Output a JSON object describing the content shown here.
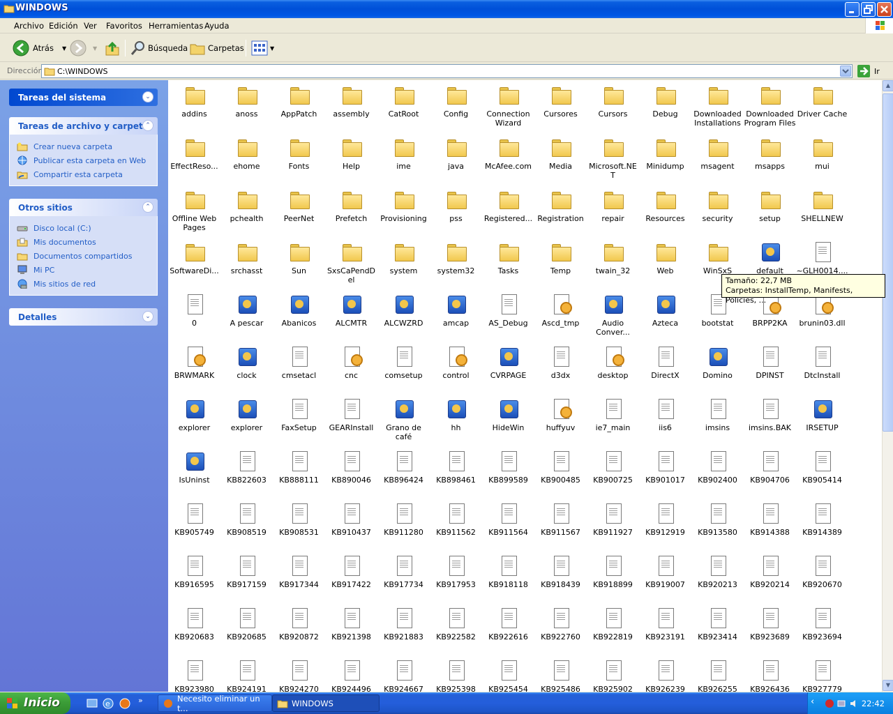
{
  "window": {
    "title": "WINDOWS"
  },
  "menu": [
    "Archivo",
    "Edición",
    "Ver",
    "Favoritos",
    "Herramientas",
    "Ayuda"
  ],
  "toolbar": {
    "back_label": "Atrás",
    "search_label": "Búsqueda",
    "folders_label": "Carpetas"
  },
  "address": {
    "label": "Dirección",
    "value": "C:\\WINDOWS",
    "go_label": "Ir"
  },
  "sidebar": {
    "system_tasks": {
      "title": "Tareas del sistema"
    },
    "file_tasks": {
      "title": "Tareas de archivo y carpeta",
      "items": [
        "Crear nueva carpeta",
        "Publicar esta carpeta en Web",
        "Compartir esta carpeta"
      ]
    },
    "other_places": {
      "title": "Otros sitios",
      "items": [
        "Disco local (C:)",
        "Mis documentos",
        "Documentos compartidos",
        "Mi PC",
        "Mis sitios de red"
      ]
    },
    "details": {
      "title": "Detalles"
    }
  },
  "files": [
    {
      "name": "addins",
      "type": "folder"
    },
    {
      "name": "anoss",
      "type": "folder"
    },
    {
      "name": "AppPatch",
      "type": "folder"
    },
    {
      "name": "assembly",
      "type": "folder"
    },
    {
      "name": "CatRoot",
      "type": "folder"
    },
    {
      "name": "Config",
      "type": "folder"
    },
    {
      "name": "Connection Wizard",
      "type": "folder"
    },
    {
      "name": "Cursores",
      "type": "folder"
    },
    {
      "name": "Cursors",
      "type": "folder"
    },
    {
      "name": "Debug",
      "type": "folder"
    },
    {
      "name": "Downloaded Installations",
      "type": "folder"
    },
    {
      "name": "Downloaded Program Files",
      "type": "folder"
    },
    {
      "name": "Driver Cache",
      "type": "folder"
    },
    {
      "name": "EffectReso...",
      "type": "folder"
    },
    {
      "name": "ehome",
      "type": "folder"
    },
    {
      "name": "Fonts",
      "type": "folder"
    },
    {
      "name": "Help",
      "type": "folder"
    },
    {
      "name": "ime",
      "type": "folder"
    },
    {
      "name": "java",
      "type": "folder"
    },
    {
      "name": "McAfee.com",
      "type": "folder"
    },
    {
      "name": "Media",
      "type": "folder"
    },
    {
      "name": "Microsoft.NET",
      "type": "folder"
    },
    {
      "name": "Minidump",
      "type": "folder"
    },
    {
      "name": "msagent",
      "type": "folder"
    },
    {
      "name": "msapps",
      "type": "folder"
    },
    {
      "name": "mui",
      "type": "folder"
    },
    {
      "name": "Offline Web Pages",
      "type": "folder"
    },
    {
      "name": "pchealth",
      "type": "folder"
    },
    {
      "name": "PeerNet",
      "type": "folder"
    },
    {
      "name": "Prefetch",
      "type": "folder"
    },
    {
      "name": "Provisioning",
      "type": "folder"
    },
    {
      "name": "pss",
      "type": "folder"
    },
    {
      "name": "Registered...",
      "type": "folder"
    },
    {
      "name": "Registration",
      "type": "folder"
    },
    {
      "name": "repair",
      "type": "folder"
    },
    {
      "name": "Resources",
      "type": "folder"
    },
    {
      "name": "security",
      "type": "folder"
    },
    {
      "name": "setup",
      "type": "folder"
    },
    {
      "name": "SHELLNEW",
      "type": "folder"
    },
    {
      "name": "SoftwareDi...",
      "type": "folder"
    },
    {
      "name": "srchasst",
      "type": "folder"
    },
    {
      "name": "Sun",
      "type": "folder"
    },
    {
      "name": "SxsCaPendDel",
      "type": "folder"
    },
    {
      "name": "system",
      "type": "folder"
    },
    {
      "name": "system32",
      "type": "folder"
    },
    {
      "name": "Tasks",
      "type": "folder"
    },
    {
      "name": "Temp",
      "type": "folder"
    },
    {
      "name": "twain_32",
      "type": "folder"
    },
    {
      "name": "Web",
      "type": "folder"
    },
    {
      "name": "WinSxS",
      "type": "folder"
    },
    {
      "name": "default",
      "type": "exe"
    },
    {
      "name": "~GLH0014....",
      "type": "doc"
    },
    {
      "name": "0",
      "type": "doc"
    },
    {
      "name": "A pescar",
      "type": "exe"
    },
    {
      "name": "Abanicos",
      "type": "exe"
    },
    {
      "name": "ALCMTR",
      "type": "exe"
    },
    {
      "name": "ALCWZRD",
      "type": "exe"
    },
    {
      "name": "amcap",
      "type": "exe"
    },
    {
      "name": "AS_Debug",
      "type": "doc"
    },
    {
      "name": "Ascd_tmp",
      "type": "cfg"
    },
    {
      "name": "Audio Conver...",
      "type": "exe"
    },
    {
      "name": "Azteca",
      "type": "exe"
    },
    {
      "name": "bootstat",
      "type": "doc"
    },
    {
      "name": "BRPP2KA",
      "type": "cfg"
    },
    {
      "name": "brunin03.dll",
      "type": "cfg"
    },
    {
      "name": "BRWMARK",
      "type": "cfg"
    },
    {
      "name": "clock",
      "type": "exe"
    },
    {
      "name": "cmsetacl",
      "type": "doc"
    },
    {
      "name": "cnc",
      "type": "cfg"
    },
    {
      "name": "comsetup",
      "type": "doc"
    },
    {
      "name": "control",
      "type": "cfg"
    },
    {
      "name": "CVRPAGE",
      "type": "exe"
    },
    {
      "name": "d3dx",
      "type": "doc"
    },
    {
      "name": "desktop",
      "type": "cfg"
    },
    {
      "name": "DirectX",
      "type": "doc"
    },
    {
      "name": "Domino",
      "type": "exe"
    },
    {
      "name": "DPINST",
      "type": "doc"
    },
    {
      "name": "DtcInstall",
      "type": "doc"
    },
    {
      "name": "explorer",
      "type": "exe"
    },
    {
      "name": "explorer",
      "type": "exe"
    },
    {
      "name": "FaxSetup",
      "type": "doc"
    },
    {
      "name": "GEARInstall",
      "type": "doc"
    },
    {
      "name": "Grano de café",
      "type": "exe"
    },
    {
      "name": "hh",
      "type": "exe"
    },
    {
      "name": "HideWin",
      "type": "exe"
    },
    {
      "name": "huffyuv",
      "type": "cfg"
    },
    {
      "name": "ie7_main",
      "type": "doc"
    },
    {
      "name": "iis6",
      "type": "doc"
    },
    {
      "name": "imsins",
      "type": "doc"
    },
    {
      "name": "imsins.BAK",
      "type": "doc"
    },
    {
      "name": "IRSETUP",
      "type": "exe"
    },
    {
      "name": "IsUninst",
      "type": "exe"
    },
    {
      "name": "KB822603",
      "type": "doc"
    },
    {
      "name": "KB888111",
      "type": "doc"
    },
    {
      "name": "KB890046",
      "type": "doc"
    },
    {
      "name": "KB896424",
      "type": "doc"
    },
    {
      "name": "KB898461",
      "type": "doc"
    },
    {
      "name": "KB899589",
      "type": "doc"
    },
    {
      "name": "KB900485",
      "type": "doc"
    },
    {
      "name": "KB900725",
      "type": "doc"
    },
    {
      "name": "KB901017",
      "type": "doc"
    },
    {
      "name": "KB902400",
      "type": "doc"
    },
    {
      "name": "KB904706",
      "type": "doc"
    },
    {
      "name": "KB905414",
      "type": "doc"
    },
    {
      "name": "KB905749",
      "type": "doc"
    },
    {
      "name": "KB908519",
      "type": "doc"
    },
    {
      "name": "KB908531",
      "type": "doc"
    },
    {
      "name": "KB910437",
      "type": "doc"
    },
    {
      "name": "KB911280",
      "type": "doc"
    },
    {
      "name": "KB911562",
      "type": "doc"
    },
    {
      "name": "KB911564",
      "type": "doc"
    },
    {
      "name": "KB911567",
      "type": "doc"
    },
    {
      "name": "KB911927",
      "type": "doc"
    },
    {
      "name": "KB912919",
      "type": "doc"
    },
    {
      "name": "KB913580",
      "type": "doc"
    },
    {
      "name": "KB914388",
      "type": "doc"
    },
    {
      "name": "KB914389",
      "type": "doc"
    },
    {
      "name": "KB916595",
      "type": "doc"
    },
    {
      "name": "KB917159",
      "type": "doc"
    },
    {
      "name": "KB917344",
      "type": "doc"
    },
    {
      "name": "KB917422",
      "type": "doc"
    },
    {
      "name": "KB917734",
      "type": "doc"
    },
    {
      "name": "KB917953",
      "type": "doc"
    },
    {
      "name": "KB918118",
      "type": "doc"
    },
    {
      "name": "KB918439",
      "type": "doc"
    },
    {
      "name": "KB918899",
      "type": "doc"
    },
    {
      "name": "KB919007",
      "type": "doc"
    },
    {
      "name": "KB920213",
      "type": "doc"
    },
    {
      "name": "KB920214",
      "type": "doc"
    },
    {
      "name": "KB920670",
      "type": "doc"
    },
    {
      "name": "KB920683",
      "type": "doc"
    },
    {
      "name": "KB920685",
      "type": "doc"
    },
    {
      "name": "KB920872",
      "type": "doc"
    },
    {
      "name": "KB921398",
      "type": "doc"
    },
    {
      "name": "KB921883",
      "type": "doc"
    },
    {
      "name": "KB922582",
      "type": "doc"
    },
    {
      "name": "KB922616",
      "type": "doc"
    },
    {
      "name": "KB922760",
      "type": "doc"
    },
    {
      "name": "KB922819",
      "type": "doc"
    },
    {
      "name": "KB923191",
      "type": "doc"
    },
    {
      "name": "KB923414",
      "type": "doc"
    },
    {
      "name": "KB923689",
      "type": "doc"
    },
    {
      "name": "KB923694",
      "type": "doc"
    },
    {
      "name": "KB923980",
      "type": "doc"
    },
    {
      "name": "KB924191",
      "type": "doc"
    },
    {
      "name": "KB924270",
      "type": "doc"
    },
    {
      "name": "KB924496",
      "type": "doc"
    },
    {
      "name": "KB924667",
      "type": "doc"
    },
    {
      "name": "KB925398",
      "type": "doc"
    },
    {
      "name": "KB925454",
      "type": "doc"
    },
    {
      "name": "KB925486",
      "type": "doc"
    },
    {
      "name": "KB925902",
      "type": "doc"
    },
    {
      "name": "KB926239",
      "type": "doc"
    },
    {
      "name": "KB926255",
      "type": "doc"
    },
    {
      "name": "KB926436",
      "type": "doc"
    },
    {
      "name": "KB927779",
      "type": "doc"
    }
  ],
  "tooltip": {
    "line1": "Tamaño: 22,7 MB",
    "line2": "Carpetas: InstallTemp, Manifests, Policies, ..."
  },
  "taskbar": {
    "start_label": "Inicio",
    "task1": "Necesito eliminar un t...",
    "task2": "WINDOWS",
    "clock": "22:42"
  },
  "colors": {
    "titlebar": "#0050D8",
    "sidebar": "#6375D6",
    "start": "#3C9D38"
  }
}
